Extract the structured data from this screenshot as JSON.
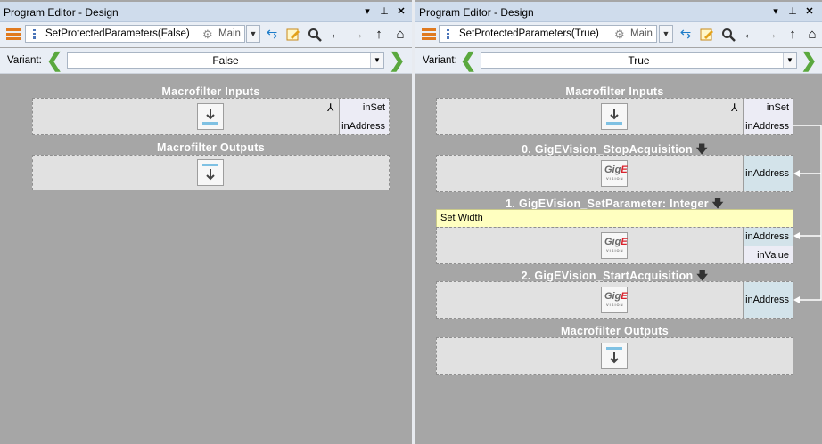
{
  "panels": [
    {
      "window_title": "Program Editor - Design",
      "macrofilter_name": "SetProtectedParameters(False)",
      "thread_label": "Main",
      "variant_label": "Variant:",
      "variant_value": "False",
      "inputs_title": "Macrofilter Inputs",
      "input_ports": [
        "inSet",
        "inAddress"
      ],
      "outputs_title": "Macrofilter Outputs",
      "filters": []
    },
    {
      "window_title": "Program Editor - Design",
      "macrofilter_name": "SetProtectedParameters(True)",
      "thread_label": "Main",
      "variant_label": "Variant:",
      "variant_value": "True",
      "inputs_title": "Macrofilter Inputs",
      "input_ports": [
        "inSet",
        "inAddress"
      ],
      "outputs_title": "Macrofilter Outputs",
      "filters": [
        {
          "title": "0. GigEVision_StopAcquisition",
          "ports": [
            "inAddress"
          ]
        },
        {
          "title": "1. GigEVision_SetParameter: Integer",
          "comment": "Set Width",
          "ports": [
            "inAddress",
            "inValue"
          ]
        },
        {
          "title": "2. GigEVision_StartAcquisition",
          "ports": [
            "inAddress"
          ]
        }
      ]
    }
  ],
  "icons": {
    "menu": "hamburger-icon",
    "swap": "swap-icon",
    "edit": "edit-icon",
    "search": "search-icon",
    "back": "arrow-left-icon",
    "forward": "arrow-right-icon",
    "up": "arrow-up-icon",
    "home": "home-icon",
    "fork": "fork-icon",
    "filter": "gige-logo-icon"
  },
  "gige_logo": "GigE",
  "gige_sub": "VISION",
  "colors": {
    "canvas": "#a6a6a6",
    "titlebar": "#cfdcec",
    "block": "#e1e1e1",
    "linked_port": "#d3e3ea",
    "comment": "#ffffc0",
    "accent_green": "#5aa83e",
    "connection": "#ffffff"
  }
}
